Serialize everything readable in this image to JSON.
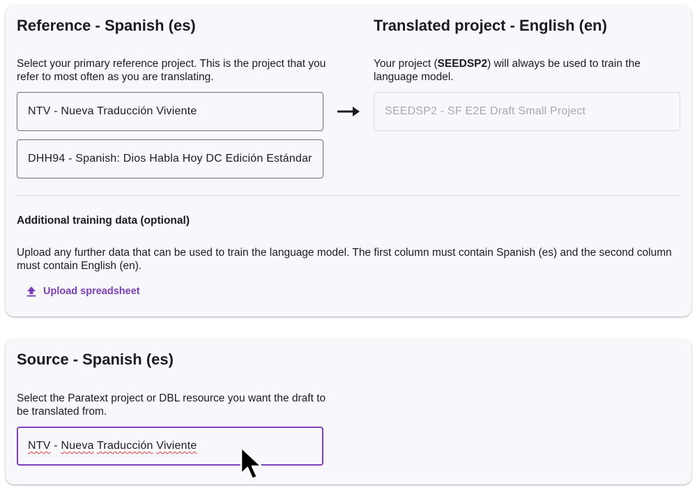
{
  "reference": {
    "title": "Reference - Spanish (es)",
    "description": "Select your primary reference project. This is the project that you refer to most often as you are translating.",
    "primary_project": "NTV - Nueva Traducción Viviente",
    "secondary_project": "DHH94 - Spanish: Dios Habla Hoy DC Edición Estándar"
  },
  "translated": {
    "title": "Translated project - English (en)",
    "description_prefix": "Your project (",
    "project_code": "SEEDSP2",
    "description_suffix": ") will always be used to train the language model.",
    "project_field": "SEEDSP2 - SF E2E Draft Small Project"
  },
  "additional": {
    "title": "Additional training data (optional)",
    "description": "Upload any further data that can be used to train the language model. The first column must contain Spanish (es) and the second column must contain English (en).",
    "upload_label": "Upload spreadsheet",
    "upload_icon": "upload-icon"
  },
  "source": {
    "title": "Source - Spanish (es)",
    "description": "Select the Paratext project or DBL resource you want the draft to be translated from.",
    "project_words": [
      "NTV",
      " - ",
      "Nueva",
      " ",
      "Traducción",
      " ",
      "Viviente"
    ]
  },
  "icons": {
    "arrow": "arrow-right-icon",
    "cursor": "mouse-pointer-icon"
  },
  "colors": {
    "accent": "#7b3fb8",
    "card_background": "#f8f7fc",
    "spellcheck": "#e53935"
  }
}
